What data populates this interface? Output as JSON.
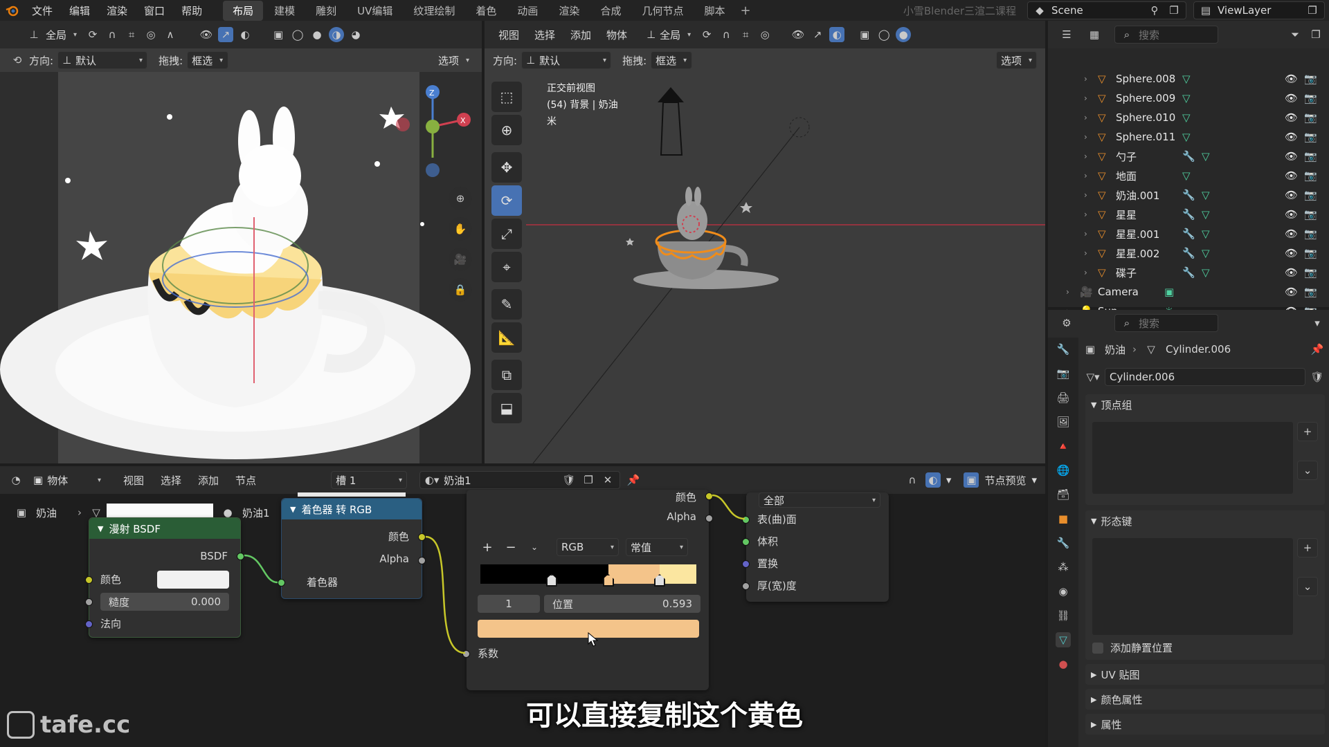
{
  "topbar": {
    "menus": [
      "文件",
      "编辑",
      "渲染",
      "窗口",
      "帮助"
    ],
    "workspaces": [
      "布局",
      "建模",
      "雕刻",
      "UV编辑",
      "纹理绘制",
      "着色",
      "动画",
      "渲染",
      "合成",
      "几何节点",
      "脚本"
    ],
    "active_workspace": "布局",
    "add_tab": "+",
    "watermark_title": "小雪Blender三渲二课程",
    "scene_label": "Scene",
    "viewlayer_label": "ViewLayer"
  },
  "left_viewport": {
    "transform_orient": "全局",
    "direction_label": "方向:",
    "direction_value": "默认",
    "drag_label": "拖拽:",
    "drag_value": "框选",
    "options_label": "选项",
    "gizmo": {
      "z": "Z",
      "x": "X"
    }
  },
  "right_viewport": {
    "menus": [
      "视图",
      "选择",
      "添加",
      "物体"
    ],
    "transform_orient": "全局",
    "direction_label": "方向:",
    "direction_value": "默认",
    "drag_label": "拖拽:",
    "drag_value": "框选",
    "options_label": "选项",
    "overlay_text": [
      "正交前视图",
      "(54) 背景 | 奶油",
      "米"
    ]
  },
  "outliner": {
    "search_placeholder": "搜索",
    "items": [
      {
        "name": "Sphere.008",
        "type": "mesh",
        "mod": false
      },
      {
        "name": "Sphere.009",
        "type": "mesh",
        "mod": false
      },
      {
        "name": "Sphere.010",
        "type": "mesh",
        "mod": false
      },
      {
        "name": "Sphere.011",
        "type": "mesh",
        "mod": false
      },
      {
        "name": "勺子",
        "type": "mesh",
        "mod": true
      },
      {
        "name": "地面",
        "type": "mesh",
        "mod": false
      },
      {
        "name": "奶油.001",
        "type": "mesh",
        "mod": true
      },
      {
        "name": "星星",
        "type": "mesh",
        "mod": true
      },
      {
        "name": "星星.001",
        "type": "mesh",
        "mod": true
      },
      {
        "name": "星星.002",
        "type": "mesh",
        "mod": true
      },
      {
        "name": "碟子",
        "type": "mesh",
        "mod": true
      },
      {
        "name": "Camera",
        "type": "camera",
        "mod": false
      },
      {
        "name": "Sun",
        "type": "light",
        "mod": false
      }
    ]
  },
  "properties": {
    "search_placeholder": "搜索",
    "breadcrumb_object": "奶油",
    "breadcrumb_mesh": "Cylinder.006",
    "mesh_name": "Cylinder.006",
    "sections": {
      "vertex_groups": "顶点组",
      "shape_keys": "形态键",
      "add_rest_position": "添加静置位置",
      "uv_maps": "UV 贴图",
      "color_attributes": "颜色属性",
      "attributes": "属性"
    }
  },
  "node_editor": {
    "editor_type": "物体",
    "menus": [
      "视图",
      "选择",
      "添加",
      "节点"
    ],
    "slot": "槽 1",
    "material": "奶油1",
    "node_preview": "节点预览",
    "breadcrumb_object": "奶油",
    "breadcrumb_material": "奶油1",
    "diffuse": {
      "title": "漫射 BSDF",
      "out": "BSDF",
      "color_label": "颜色",
      "roughness_label": "糙度",
      "roughness_value": "0.000",
      "normal_label": "法向"
    },
    "shader_to_rgb": {
      "title": "着色器 转 RGB",
      "out_color": "颜色",
      "out_alpha": "Alpha",
      "in_shader": "着色器"
    },
    "color_ramp": {
      "out_color": "颜色",
      "out_alpha": "Alpha",
      "plus": "+",
      "minus": "−",
      "mode": "RGB",
      "interp": "常值",
      "stop_index": "1",
      "pos_label": "位置",
      "pos_value": "0.593",
      "fac_label": "系数",
      "active_color": "#f4c48a",
      "stops": [
        0.33,
        0.593,
        0.83
      ]
    },
    "output": {
      "target": "全部",
      "surface": "表(曲)面",
      "volume": "体积",
      "displacement": "置换",
      "thickness": "厚(宽)度"
    }
  },
  "subtitle": "可以直接复制这个黄色",
  "logo_text": "tafe.cc"
}
